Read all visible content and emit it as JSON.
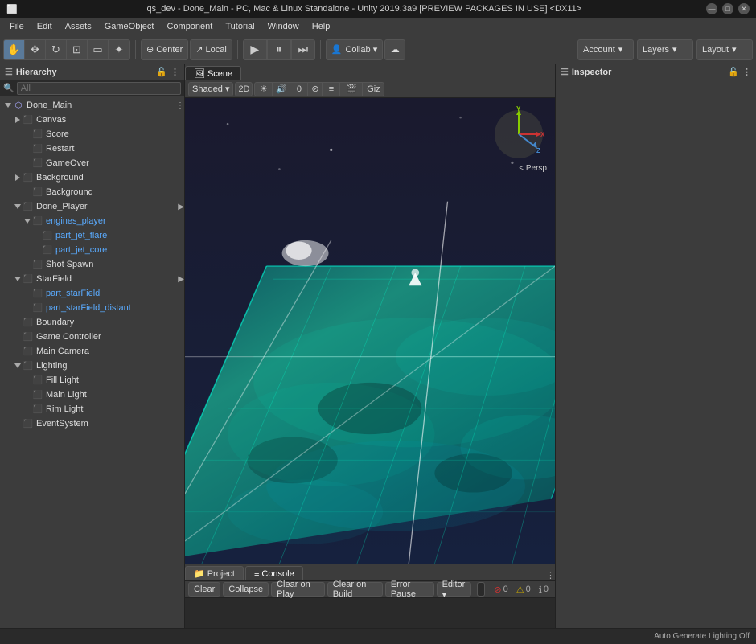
{
  "titlebar": {
    "text": "qs_dev - Done_Main - PC, Mac & Linux Standalone - Unity 2019.3a9 [PREVIEW PACKAGES IN USE] <DX11>",
    "min": "—",
    "max": "□",
    "close": "✕"
  },
  "menu": {
    "items": [
      "File",
      "Edit",
      "Assets",
      "GameObject",
      "Component",
      "Tutorial",
      "Window",
      "Help"
    ]
  },
  "toolbar": {
    "transform_tools": [
      "✋",
      "✥",
      "⊕",
      "▭",
      "⊡",
      "✦"
    ],
    "pivot_center": "Center",
    "pivot_local": "Local",
    "play": "▶",
    "pause": "⏸",
    "step": "⏭",
    "collab": "Collab ▾",
    "cloud": "☁",
    "account": "Account",
    "layers": "Layers",
    "layout": "Layout"
  },
  "hierarchy": {
    "title": "Hierarchy",
    "search_placeholder": "All",
    "tree": [
      {
        "id": "done_main",
        "label": "Done_Main",
        "indent": 0,
        "arrow": "down",
        "type": "gameobj",
        "has_more": true
      },
      {
        "id": "canvas",
        "label": "Canvas",
        "indent": 1,
        "arrow": "right",
        "type": "cube"
      },
      {
        "id": "score",
        "label": "Score",
        "indent": 2,
        "arrow": "",
        "type": "cube"
      },
      {
        "id": "restart",
        "label": "Restart",
        "indent": 2,
        "arrow": "",
        "type": "cube"
      },
      {
        "id": "gameover",
        "label": "GameOver",
        "indent": 2,
        "arrow": "",
        "type": "cube"
      },
      {
        "id": "background_parent",
        "label": "Background",
        "indent": 1,
        "arrow": "right",
        "type": "cube"
      },
      {
        "id": "background_child",
        "label": "Background",
        "indent": 2,
        "arrow": "",
        "type": "cube"
      },
      {
        "id": "done_player",
        "label": "Done_Player",
        "indent": 1,
        "arrow": "down",
        "type": "cube",
        "has_more": true
      },
      {
        "id": "engines_player",
        "label": "engines_player",
        "indent": 2,
        "arrow": "down",
        "type": "cube",
        "color": "blue"
      },
      {
        "id": "part_jet_flare",
        "label": "part_jet_flare",
        "indent": 3,
        "arrow": "",
        "type": "cube",
        "color": "blue"
      },
      {
        "id": "part_jet_core",
        "label": "part_jet_core",
        "indent": 3,
        "arrow": "",
        "type": "cube",
        "color": "blue"
      },
      {
        "id": "shot_spawn",
        "label": "Shot Spawn",
        "indent": 2,
        "arrow": "",
        "type": "cube"
      },
      {
        "id": "starfield",
        "label": "StarField",
        "indent": 1,
        "arrow": "down",
        "type": "cube",
        "has_more": true
      },
      {
        "id": "part_starfield",
        "label": "part_starField",
        "indent": 2,
        "arrow": "",
        "type": "cube",
        "color": "blue"
      },
      {
        "id": "part_starfield_distant",
        "label": "part_starField_distant",
        "indent": 2,
        "arrow": "",
        "type": "cube",
        "color": "blue"
      },
      {
        "id": "boundary",
        "label": "Boundary",
        "indent": 1,
        "arrow": "",
        "type": "cube"
      },
      {
        "id": "game_controller",
        "label": "Game Controller",
        "indent": 1,
        "arrow": "",
        "type": "cube"
      },
      {
        "id": "main_camera",
        "label": "Main Camera",
        "indent": 1,
        "arrow": "",
        "type": "cube"
      },
      {
        "id": "lighting",
        "label": "Lighting",
        "indent": 1,
        "arrow": "down",
        "type": "cube"
      },
      {
        "id": "fill_light",
        "label": "Fill Light",
        "indent": 2,
        "arrow": "",
        "type": "cube"
      },
      {
        "id": "main_light",
        "label": "Main Light",
        "indent": 2,
        "arrow": "",
        "type": "cube"
      },
      {
        "id": "rim_light",
        "label": "Rim Light",
        "indent": 2,
        "arrow": "",
        "type": "cube"
      },
      {
        "id": "eventsystem",
        "label": "EventSystem",
        "indent": 1,
        "arrow": "",
        "type": "cube"
      }
    ]
  },
  "scene": {
    "tabs": [
      "Scene"
    ],
    "active_tab": "Scene",
    "shading": "Shaded",
    "mode": "2D",
    "persp_label": "< Persp"
  },
  "inspector": {
    "title": "Inspector"
  },
  "bottom": {
    "tabs": [
      "Project",
      "Console"
    ],
    "active_tab": "Console",
    "buttons": {
      "clear": "Clear",
      "collapse": "Collapse",
      "clear_on_play": "Clear on Play",
      "clear_on_build": "Clear on Build",
      "error_pause": "Error Pause",
      "editor": "Editor ▾"
    },
    "search_placeholder": "",
    "counts": {
      "errors": "0",
      "warnings": "0",
      "logs": "0"
    },
    "more_icon": "⋮"
  },
  "statusbar": {
    "text": "Auto Generate Lighting Off"
  }
}
